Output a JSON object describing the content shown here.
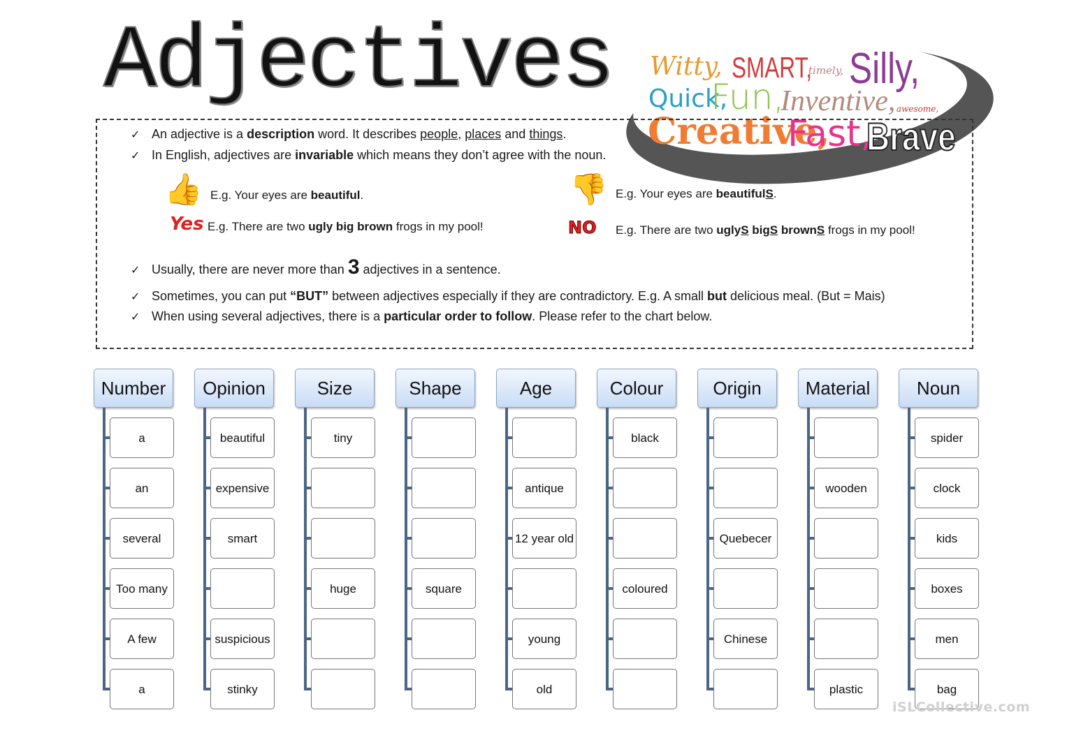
{
  "title": "Adjectives",
  "word_art": {
    "words": [
      "Witty,",
      "SMART,",
      "timely,",
      "Silly,",
      "Quick,",
      "Fun,",
      "Inventive,",
      "awesome,",
      "Creative,",
      "Fast,",
      "Brave"
    ]
  },
  "rules": [
    {
      "pre": "An adjective is a ",
      "bold": "description",
      "mid": " word. It describes ",
      "u1": "people",
      "c1": ", ",
      "u2": "places",
      "c2": " and ",
      "u3": "things",
      "end": "."
    },
    {
      "pre": "In English, adjectives are ",
      "bold": "invariable",
      "end": " which means they don’t agree with the noun."
    },
    {
      "pre": "Usually, there are never more than ",
      "big": "3",
      "end": " adjectives in a sentence."
    },
    {
      "pre": "Sometimes, you can put ",
      "bold": "“BUT”",
      "mid": " between adjectives especially if they are contradictory. E.g. A small ",
      "bold2": "but",
      "end": " delicious meal. (But = Mais)"
    },
    {
      "pre": "When using several adjectives, there is a ",
      "bold": "particular order to follow",
      "end": ". Please refer to the chart below."
    }
  ],
  "check_glyph": "✓",
  "examples": {
    "yes_label": "Yes",
    "no_label": "NO",
    "yes": [
      {
        "pre": "E.g. Your eyes are ",
        "bold": "beautiful",
        "end": "."
      },
      {
        "pre": "E.g.  There are two ",
        "bold": "ugly big brown",
        "end": " frogs in my pool!"
      }
    ],
    "no": [
      {
        "pre": "E.g. Your eyes are ",
        "bold": "beautiful",
        "bold_u": "S",
        "end": "."
      },
      {
        "pre": "E.g. There are two ",
        "w1": "ugly",
        "w2": "big",
        "w3": "brown",
        "s": "S",
        "end": " frogs in my pool!"
      }
    ]
  },
  "chart": {
    "columns": [
      {
        "header": "Number",
        "cells": [
          "a",
          "an",
          "several",
          "Too many",
          "A few",
          "a"
        ]
      },
      {
        "header": "Opinion",
        "cells": [
          "beautiful",
          "expensive",
          "smart",
          "",
          "suspicious",
          "stinky"
        ]
      },
      {
        "header": "Size",
        "cells": [
          "tiny",
          "",
          "",
          "huge",
          "",
          ""
        ]
      },
      {
        "header": "Shape",
        "cells": [
          "",
          "",
          "",
          "square",
          "",
          ""
        ]
      },
      {
        "header": "Age",
        "cells": [
          "",
          "antique",
          "12 year old",
          "",
          "young",
          "old"
        ]
      },
      {
        "header": "Colour",
        "cells": [
          "black",
          "",
          "",
          "coloured",
          "",
          ""
        ]
      },
      {
        "header": "Origin",
        "cells": [
          "",
          "",
          "Quebecer",
          "",
          "Chinese",
          ""
        ]
      },
      {
        "header": "Material",
        "cells": [
          "",
          "wooden",
          "",
          "",
          "",
          "plastic"
        ]
      },
      {
        "header": "Noun",
        "cells": [
          "spider",
          "clock",
          "kids",
          "boxes",
          "men",
          "bag"
        ]
      }
    ]
  },
  "watermark": "iSLCollective.com"
}
